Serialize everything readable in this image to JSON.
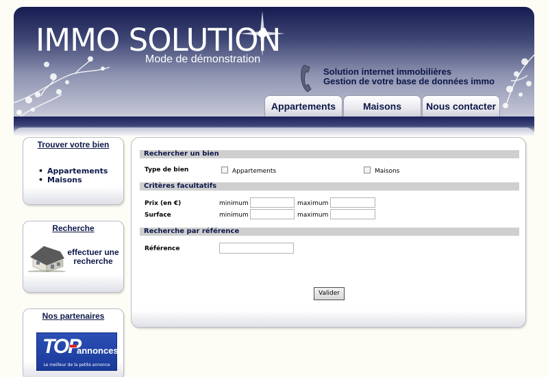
{
  "header": {
    "title": "IMMO SOLUTION",
    "subtitle": "Mode de démonstration",
    "tagline_line1": "Solution internet immobilières",
    "tagline_line2": "Gestion de votre base de données immo",
    "phone_icon": "telephone-handset-icon",
    "tabs": [
      {
        "label": "Appartements"
      },
      {
        "label": "Maisons"
      },
      {
        "label": "Nous contacter"
      }
    ]
  },
  "sidebar": {
    "find": {
      "title": "Trouver votre bien",
      "items": [
        {
          "label": "Appartements"
        },
        {
          "label": "Maisons"
        }
      ]
    },
    "search": {
      "title": "Recherche",
      "cta_line1": "effectuer une",
      "cta_line2": "recherche",
      "image_icon": "house-icon"
    },
    "partners": {
      "title": "Nos partenaires",
      "logo_word1": "TOP",
      "logo_word2": "annonces",
      "logo_slogan": "Le meilleur de la petite annonce"
    }
  },
  "form": {
    "section1": {
      "title": "Rechercher un bien",
      "type_label": "Type de bien",
      "options": [
        {
          "label": "Appartements",
          "checked": false
        },
        {
          "label": "Maisons",
          "checked": false
        }
      ]
    },
    "section2": {
      "title": "Critères facultatifs",
      "rows": [
        {
          "label": "Prix (en €)",
          "min_label": "minimum",
          "max_label": "maximum",
          "min_value": "",
          "max_value": ""
        },
        {
          "label": "Surface",
          "min_label": "minimum",
          "max_label": "maximum",
          "min_value": "",
          "max_value": ""
        }
      ]
    },
    "section3": {
      "title": "Recherche par référence",
      "ref_label": "Référence",
      "ref_value": ""
    },
    "submit_label": "Valider"
  },
  "colors": {
    "header_dark": "#161c50",
    "header_light": "#c6c8d7",
    "accent_text": "#0d1748",
    "section_bar": "#cfcfcf",
    "page_bg": "#fdfdf6"
  }
}
